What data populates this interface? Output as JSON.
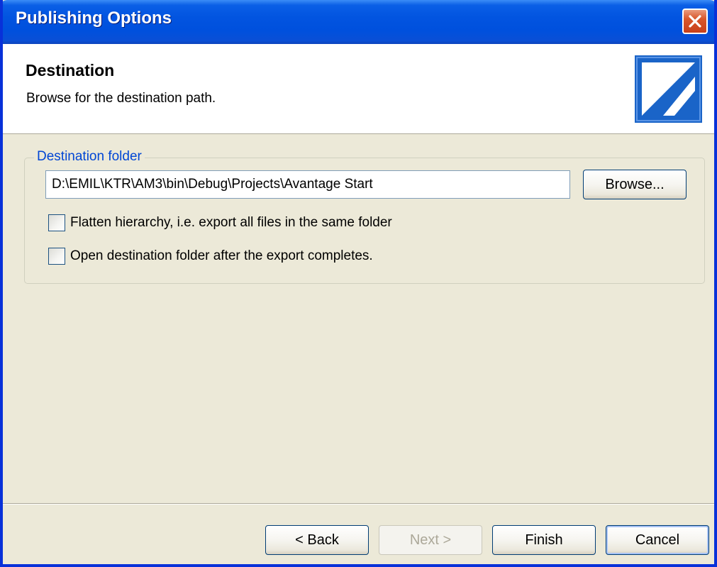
{
  "window": {
    "title": "Publishing Options"
  },
  "header": {
    "title": "Destination",
    "subtitle": "Browse for the destination path.",
    "logo_icon": "app-logo-icon"
  },
  "destination": {
    "legend": "Destination folder",
    "path_value": "D:\\EMIL\\KTR\\AM3\\bin\\Debug\\Projects\\Avantage Start",
    "browse_label": "Browse...",
    "flatten_label": "Flatten hierarchy, i.e. export all files in the same folder",
    "flatten_checked": false,
    "open_folder_label": "Open destination folder after the export completes.",
    "open_folder_checked": false
  },
  "footer": {
    "back_label": "< Back",
    "next_label": "Next >",
    "next_enabled": false,
    "finish_label": "Finish",
    "cancel_label": "Cancel"
  },
  "colors": {
    "titlebar": "#0054e3",
    "dialog_bg": "#ece9d8",
    "legend_text": "#0046d5",
    "close_button": "#d8562b"
  }
}
